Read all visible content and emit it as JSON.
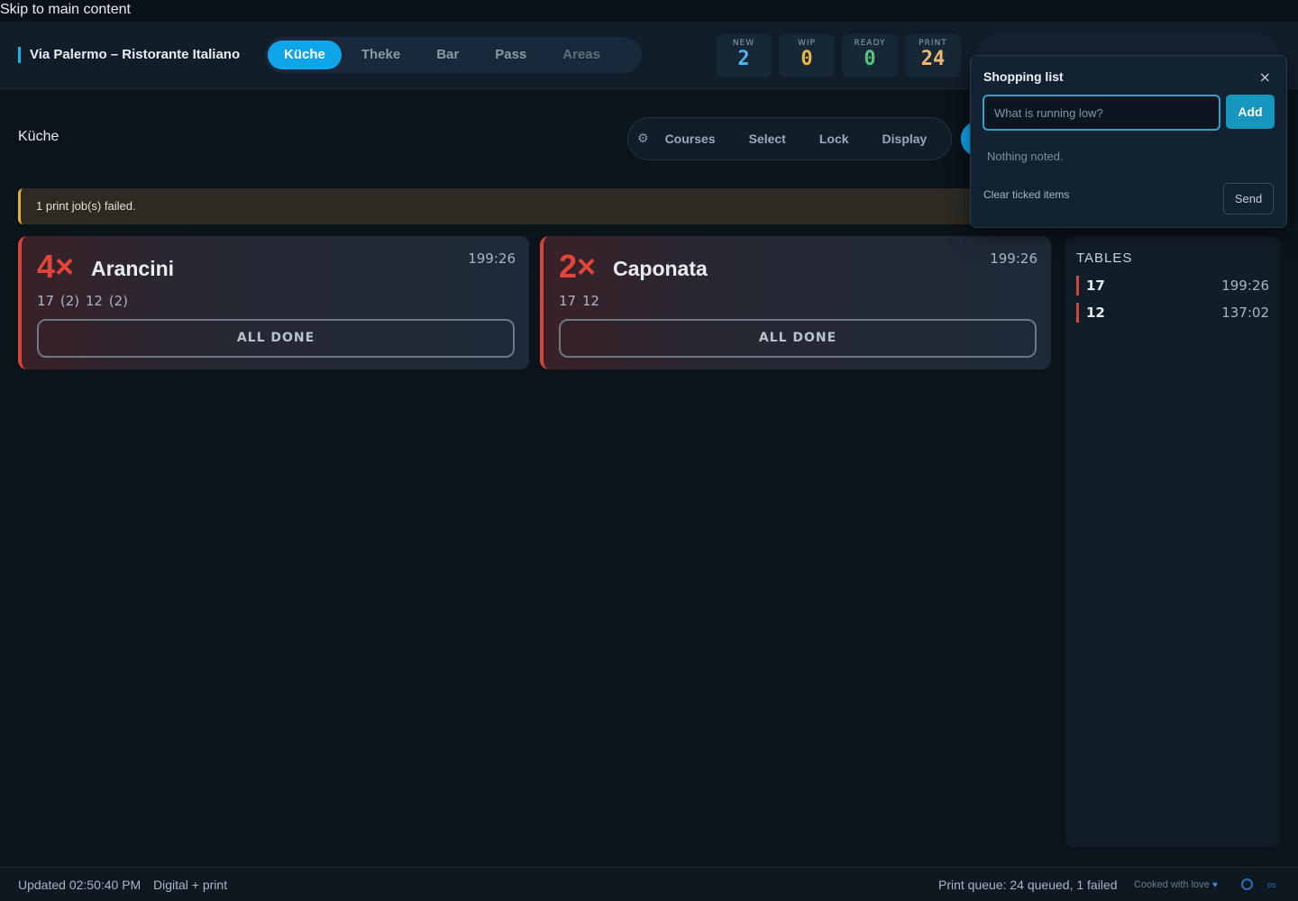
{
  "skip_link": "Skip to main content",
  "header": {
    "brand": "Via Palermo – Ristorante Italiano",
    "tabs": [
      {
        "label": "Küche",
        "active": true
      },
      {
        "label": "Theke"
      },
      {
        "label": "Bar"
      },
      {
        "label": "Pass"
      },
      {
        "label": "Areas"
      }
    ],
    "stats": [
      {
        "label": "NEW",
        "value": "2",
        "color": "#4fb7f0"
      },
      {
        "label": "WIP",
        "value": "0",
        "color": "#e6b550"
      },
      {
        "label": "READY",
        "value": "0",
        "color": "#56c27a"
      },
      {
        "label": "PRINT",
        "value": "24",
        "color": "#f0b872"
      }
    ]
  },
  "section": {
    "title": "Küche"
  },
  "toolbar": {
    "gear_icon": "gear-icon",
    "buttons": [
      "Courses",
      "Select",
      "Lock",
      "Display"
    ]
  },
  "alert": {
    "text": "1 print job(s) failed."
  },
  "cards": [
    {
      "qty": "4×",
      "name": "Arancini",
      "time": "199:26",
      "tables": "17 (2)  12 (2)",
      "action": "ALL DONE"
    },
    {
      "qty": "2×",
      "name": "Caponata",
      "time": "199:26",
      "tables": "17  12",
      "action": "ALL DONE"
    }
  ],
  "tables_panel": {
    "title": "TABLES",
    "rows": [
      {
        "table": "17",
        "time": "199:26"
      },
      {
        "table": "12",
        "time": "137:02"
      }
    ]
  },
  "shopping_list": {
    "title": "Shopping list",
    "close": "×",
    "input_placeholder": "What is running low?",
    "input_value": "",
    "add_label": "Add",
    "empty_text": "Nothing noted.",
    "clear_label": "Clear ticked items",
    "send_label": "Send"
  },
  "footer": {
    "updated": "Updated 02:50:40 PM",
    "mode": "Digital + print",
    "queue": "Print queue: 24 queued, 1 failed",
    "credit": "Cooked with love",
    "heart": "♥",
    "os": "os"
  },
  "colors": {
    "accent": "#0ea5e9",
    "alert": "#e2b23a",
    "urgent": "#d6453a"
  }
}
